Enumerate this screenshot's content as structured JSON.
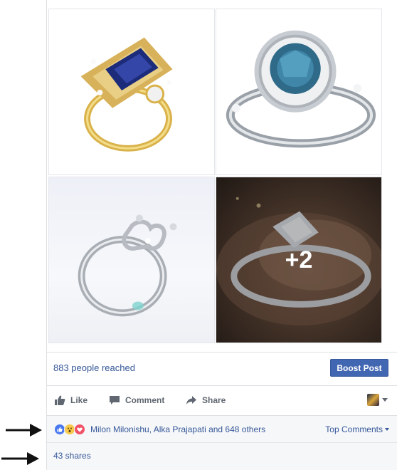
{
  "post": {
    "photos": [
      {
        "icon": "ring-sapphire-gold-photo"
      },
      {
        "icon": "ring-blue-diamond-silver-photo"
      },
      {
        "icon": "ring-crown-silver-photo"
      },
      {
        "icon": "ring-on-hand-photo",
        "more_label": "+2"
      }
    ],
    "reach": {
      "text": "883 people reached",
      "boost_label": "Boost Post"
    },
    "actions": {
      "like": "Like",
      "comment": "Comment",
      "share": "Share"
    },
    "reactions": {
      "icons": [
        "like-reaction-icon",
        "wow-reaction-icon",
        "love-reaction-icon"
      ],
      "reactors_text": "Milon Milonishu, Alka Prajapati and 648 others",
      "top_comments_label": "Top Comments"
    },
    "shares_text": "43 shares"
  },
  "colors": {
    "link": "#365899",
    "boost": "#4267b2",
    "like_blue": "#4a78ee",
    "love_red": "#f25268",
    "wow_yellow": "#f7c94c",
    "action_grey": "#606770",
    "panel_bg": "#f6f7f9"
  }
}
